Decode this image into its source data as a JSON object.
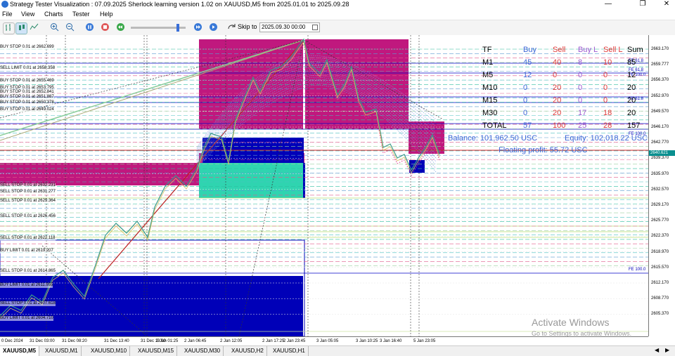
{
  "window": {
    "title": "Strategy Tester Visualization : 07.09.2025 Sherlock learning version 1.02 on XAUUSD,M5 from 2025.01.01 to 2025.09.28",
    "controls": {
      "minimize": "—",
      "maximize": "❐",
      "close": "✕"
    }
  },
  "menu": [
    "File",
    "View",
    "Charts",
    "Tester",
    "Help"
  ],
  "toolbar": {
    "skip_label": "Skip to",
    "skip_date": "2025.09.30 00:00",
    "slider_percent": 88,
    "icons": [
      "chart-bars-icon",
      "chart-candles-icon",
      "chart-line-icon",
      "zoom-in-icon",
      "zoom-out-icon",
      "pause-icon",
      "stop-icon",
      "rewind-icon",
      "fast-forward-icon",
      "skip-to-icon",
      "calendar-icon"
    ]
  },
  "price_axis": {
    "labels": [
      "2663.170",
      "2659.777",
      "2656.370",
      "2652.970",
      "2649.570",
      "2646.170",
      "2642.770",
      "2639.370",
      "2635.970",
      "2632.570",
      "2629.170",
      "2625.770",
      "2622.370",
      "2618.970",
      "2615.570",
      "2612.170",
      "2608.770",
      "2605.370"
    ],
    "current": "2640.621"
  },
  "time_axis": {
    "labels": [
      "0 Dec 2024",
      "31 Dec 03:00",
      "31 Dec 08:20",
      "31 Dec 13:40",
      "31 Dec 19:00",
      "2 Jan 01:25",
      "2 Jan 06:45",
      "2 Jan 12:05",
      "2 Jan 17:25",
      "2 Jan 23:45",
      "3 Jan 05:05",
      "3 Jan 10:25",
      "3 Jan 16:40",
      "5 Jan 23:05"
    ]
  },
  "orders": [
    "BUY STOP 0.01 at 2662.699",
    "SELL LIMIT 0.01 at 2658.358",
    "BUY STOP 0.01 at 2655.469",
    "BUY STOP 0.01 at 2653.795",
    "BUY STOP 0.01 at 2652.841",
    "BUY STOP 0.01 at 2651.887",
    "BUY STOP 0.01 at 2650.378",
    "BUY STOP 0.01 at 2649.024",
    "SELL STOP 0.01 at 2632.231",
    "SELL STOP 0.01 at 2631.277",
    "SELL STOP 0.01 at 2629.364",
    "SELL STOP 0.01 at 2626.456",
    "SELL STOP 0.01 at 2622.118",
    "BUY LIMIT 0.01 at 2619.207",
    "SELL STOP 0.01 at 2614.865",
    "BUY LIMIT 0.01 at 2611.955",
    "SELL STOP 0.01 at 2607.618",
    "BUY LIMIT 0.01 at 2604.710"
  ],
  "fib_labels": [
    {
      "text": "FE 61.8",
      "price_label": 0
    },
    {
      "text": "FE 61.8",
      "price_label": 1
    },
    {
      "text": "FE 100.0",
      "price_label": 1
    },
    {
      "text": "FE 61.8",
      "price_label": 4
    },
    {
      "text": "FE 100.0",
      "price_label": 6
    },
    {
      "text": "FE 100.0",
      "price_label": 14
    }
  ],
  "stats": {
    "headers": [
      "TF",
      "Buy",
      "Sell",
      "Buy L",
      "Sell L",
      "Sum"
    ],
    "rows": [
      [
        "M1",
        "45",
        "40",
        "8",
        "10",
        "85"
      ],
      [
        "M5",
        "12",
        "0",
        "0",
        "0",
        "12"
      ],
      [
        "M10",
        "0",
        "20",
        "0",
        "0",
        "20"
      ],
      [
        "M15",
        "0",
        "20",
        "0",
        "0",
        "20"
      ],
      [
        "M30",
        "0",
        "20",
        "17",
        "18",
        "20"
      ],
      [
        "TOTAL",
        "57",
        "100",
        "25",
        "28",
        "157"
      ]
    ],
    "balance": "Balance: 101,962.50 USC",
    "equity": "Equity: 102,018.22 USC",
    "floating": "Floating profit: 55.72 USC"
  },
  "watermark": {
    "line1": "Activate Windows",
    "line2": "Go to Settings to activate Windows."
  },
  "tabs": [
    "XAUUSD,M5",
    "XAUUSD,M1",
    "XAUUSD,M10",
    "XAUUSD,M15",
    "XAUUSD,M30",
    "XAUUSD,H2",
    "XAUUSD,H1"
  ],
  "colors": {
    "magenta": "#c0187e",
    "blue": "#0000b8",
    "teal": "#2fd4b0",
    "buy_col": "#3b66d6",
    "sell_col": "#e03a3a",
    "buyl_col": "#9b59d0",
    "selll_col": "#e03a3a",
    "candle": "#3a9a8a"
  }
}
